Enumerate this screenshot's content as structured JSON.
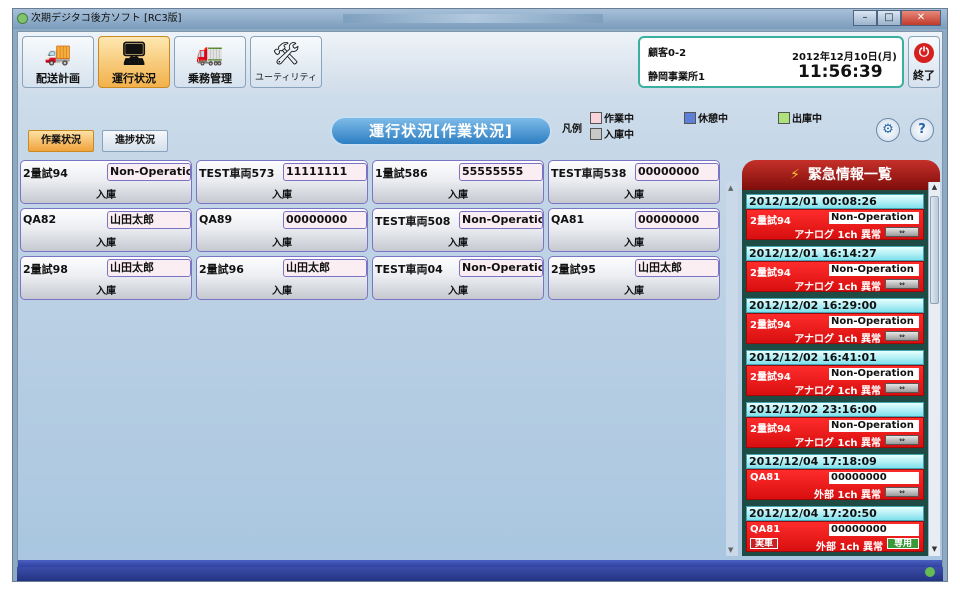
{
  "window": {
    "title": "次期デジタコ後方ソフト [RC3版]"
  },
  "toolbar": {
    "haisou": "配送計画",
    "unkou": "運行状況",
    "jomu": "乗務管理",
    "utility": "ユーティリティ",
    "exit": "終了"
  },
  "header": {
    "customer": "顧客0-2",
    "office": "静岡事業所1",
    "date": "2012年12月10日(月)",
    "time": "11:56:39"
  },
  "tabs": {
    "sagyou": "作業状況",
    "shinchoku": "進捗状況"
  },
  "banner": "運行状況[作業状況]",
  "legend": {
    "label": "凡例",
    "items": [
      {
        "label": "作業中",
        "color": "#f8d3dc"
      },
      {
        "label": "休憩中",
        "color": "#5d7fd8"
      },
      {
        "label": "出庫中",
        "color": "#aee27a"
      },
      {
        "label": "入庫中",
        "color": "#c8c8c8"
      }
    ]
  },
  "vehicles": [
    {
      "name": "2量試94",
      "driver": "Non-Operation",
      "status": "入庫"
    },
    {
      "name": "TEST車両573",
      "driver": "11111111",
      "status": "入庫"
    },
    {
      "name": "1量試586",
      "driver": "55555555",
      "status": "入庫"
    },
    {
      "name": "TEST車両538",
      "driver": "00000000",
      "status": "入庫"
    },
    {
      "name": "QA82",
      "driver": "山田太郎",
      "status": "入庫"
    },
    {
      "name": "QA89",
      "driver": "00000000",
      "status": "入庫"
    },
    {
      "name": "TEST車両508",
      "driver": "Non-Operation",
      "status": "入庫"
    },
    {
      "name": "QA81",
      "driver": "00000000",
      "status": "入庫"
    },
    {
      "name": "2量試98",
      "driver": "山田太郎",
      "status": "入庫"
    },
    {
      "name": "2量試96",
      "driver": "山田太郎",
      "status": "入庫"
    },
    {
      "name": "TEST車両04",
      "driver": "Non-Operation",
      "status": "入庫"
    },
    {
      "name": "2量試95",
      "driver": "山田太郎",
      "status": "入庫"
    }
  ],
  "emergency": {
    "title": "緊急情報一覧",
    "items": [
      {
        "datetime": "2012/12/01 00:08:26",
        "vehicle": "2量試94",
        "operator": "Non-Operation",
        "type": "アナログ 1ch 異常"
      },
      {
        "datetime": "2012/12/01 16:14:27",
        "vehicle": "2量試94",
        "operator": "Non-Operation",
        "type": "アナログ 1ch 異常"
      },
      {
        "datetime": "2012/12/02 16:29:00",
        "vehicle": "2量試94",
        "operator": "Non-Operation",
        "type": "アナログ 1ch 異常"
      },
      {
        "datetime": "2012/12/02 16:41:01",
        "vehicle": "2量試94",
        "operator": "Non-Operation",
        "type": "アナログ 1ch 異常"
      },
      {
        "datetime": "2012/12/02 23:16:00",
        "vehicle": "2量試94",
        "operator": "Non-Operation",
        "type": "アナログ 1ch 異常"
      },
      {
        "datetime": "2012/12/04 17:18:09",
        "vehicle": "QA81",
        "operator": "00000000",
        "type": "外部 1ch 異常"
      },
      {
        "datetime": "2012/12/04 17:20:50",
        "vehicle": "QA81",
        "operator": "00000000",
        "type": "外部 1ch 異常",
        "tag_left": "実車",
        "tag_right": "専用"
      }
    ]
  }
}
